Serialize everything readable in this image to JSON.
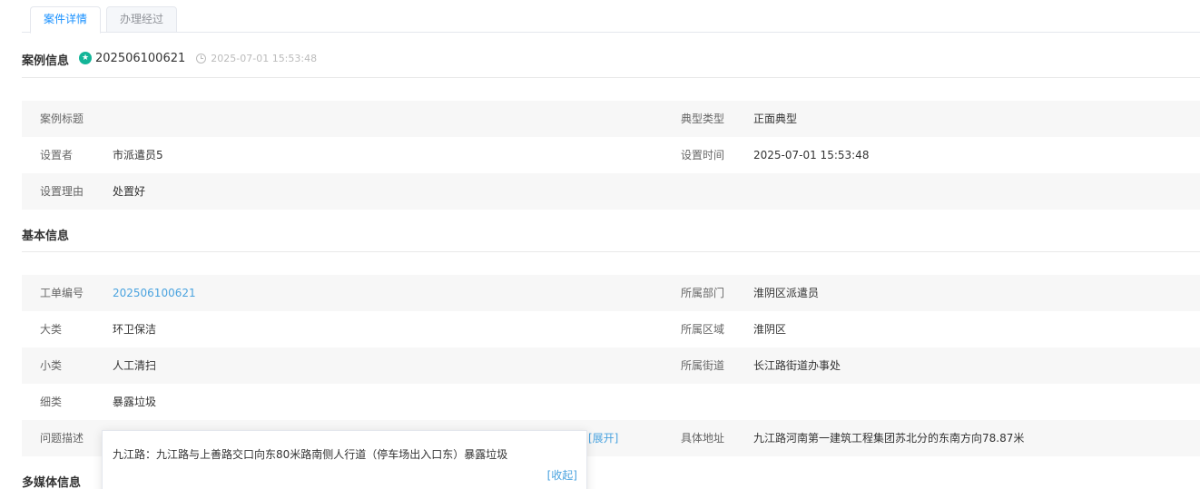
{
  "tabs": [
    "案件详情",
    "办理经过"
  ],
  "case_info": {
    "title": "案例信息",
    "id": "202506100621",
    "time": "2025-07-01 15:53:48",
    "rows": [
      {
        "l1": "案例标题",
        "v1": "",
        "l2": "典型类型",
        "v2": "正面典型"
      },
      {
        "l1": "设置者",
        "v1": "市派遣员5",
        "l2": "设置时间",
        "v2": "2025-07-01 15:53:48"
      },
      {
        "l1": "设置理由",
        "v1": "处置好",
        "l2": "",
        "v2": ""
      }
    ]
  },
  "basic_info": {
    "title": "基本信息",
    "rows": [
      {
        "l1": "工单编号",
        "v1": "202506100621",
        "l2": "所属部门",
        "v2": "淮阴区派遣员"
      },
      {
        "l1": "大类",
        "v1": "环卫保洁",
        "l2": "所属区域",
        "v2": "淮阴区"
      },
      {
        "l1": "小类",
        "v1": "人工清扫",
        "l2": "所属街道",
        "v2": "长江路街道办事处"
      },
      {
        "l1": "细类",
        "v1": "暴露垃圾",
        "l2": "",
        "v2": ""
      },
      {
        "l1": "问题描述",
        "v1": "",
        "l2": "具体地址",
        "v2": "九江路河南第一建筑工程集团苏北分的东南方向78.87米"
      }
    ],
    "expand_label": "[展开]"
  },
  "popover": {
    "text": "九江路：九江路与上善路交口向东80米路南侧人行道（停车场出入口东）暴露垃圾",
    "collapse_label": "[收起]"
  },
  "media_info": {
    "title": "多媒体信息"
  }
}
